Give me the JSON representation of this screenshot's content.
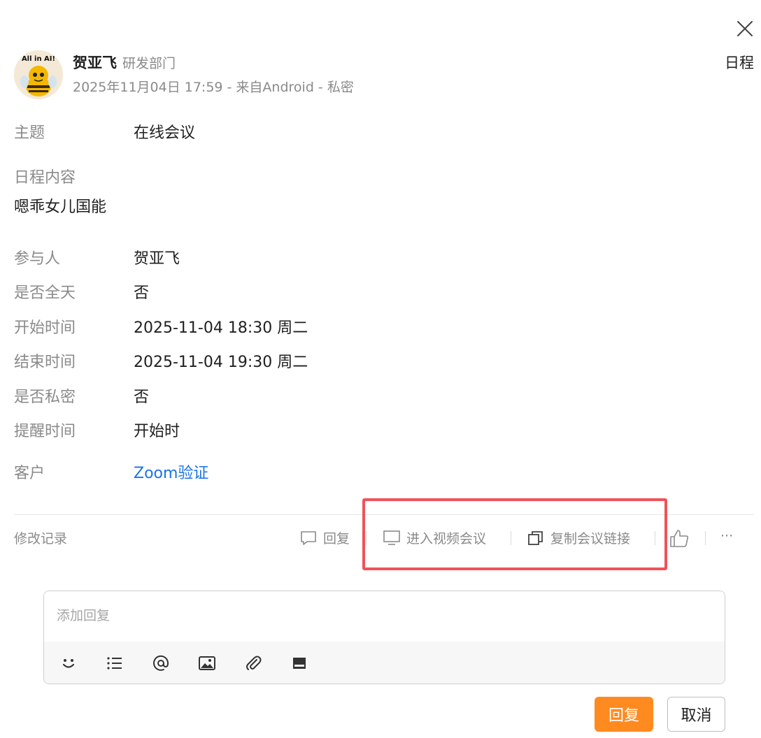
{
  "header": {
    "type_label": "日程",
    "author_name": "贺亚飞",
    "author_dept": "研发部门",
    "meta": "2025年11月04日 17:59 - 来自Android - 私密",
    "avatar_text": "All in AI!"
  },
  "subject": {
    "label": "主题",
    "value": "在线会议"
  },
  "content": {
    "label": "日程内容",
    "value": "嗯乖女儿国能"
  },
  "details": [
    {
      "label": "参与人",
      "value": "贺亚飞"
    },
    {
      "label": "是否全天",
      "value": "否"
    },
    {
      "label": "开始时间",
      "value": "2025-11-04 18:30 周二"
    },
    {
      "label": "结束时间",
      "value": "2025-11-04 19:30 周二"
    },
    {
      "label": "是否私密",
      "value": "否"
    },
    {
      "label": "提醒时间",
      "value": "开始时"
    }
  ],
  "customer": {
    "label": "客户",
    "value": "Zoom验证"
  },
  "actions": {
    "history": "修改记录",
    "reply": "回复",
    "enter_video": "进入视频会议",
    "copy_link": "复制会议链接",
    "more": "···"
  },
  "reply_box": {
    "placeholder": "添加回复",
    "submit": "回复",
    "cancel": "取消"
  },
  "colors": {
    "accent_orange": "#ff8a1f",
    "link_blue": "#1a73e8",
    "highlight_red": "#f0525a",
    "muted_text": "#8a8a8a"
  }
}
